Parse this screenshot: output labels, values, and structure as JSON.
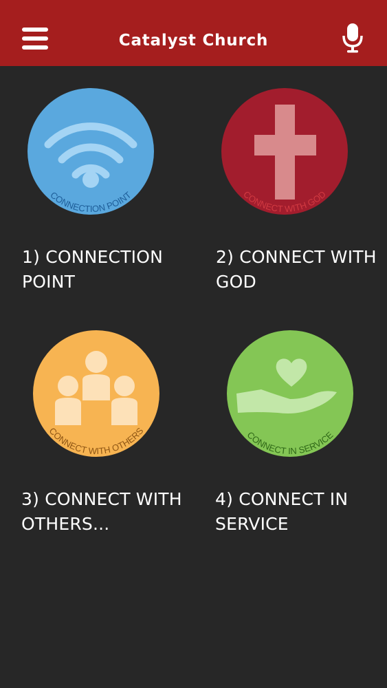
{
  "header": {
    "title": "Catalyst Church",
    "menu_icon": "hamburger-menu-icon",
    "mic_icon": "microphone-icon"
  },
  "colors": {
    "header": "#a51e1e",
    "background": "#272727",
    "connection_point": "#5aa8de",
    "connect_with_god": "#a21d2d",
    "connect_with_others": "#f7b452",
    "connect_in_service": "#84c655"
  },
  "tiles": [
    {
      "label": "1) CONNECTION POINT",
      "badge_text": "CONNECTION POINT",
      "icon": "wifi-icon"
    },
    {
      "label": "2) CONNECT WITH GOD",
      "badge_text": "CONNECT WITH GOD",
      "icon": "cross-icon"
    },
    {
      "label": "3) CONNECT WITH OTHERS...",
      "badge_text": "CONNECT WITH OTHERS",
      "icon": "people-group-icon"
    },
    {
      "label": "4) CONNECT IN SERVICE",
      "badge_text": "CONNECT IN SERVICE",
      "icon": "hand-heart-icon"
    }
  ]
}
